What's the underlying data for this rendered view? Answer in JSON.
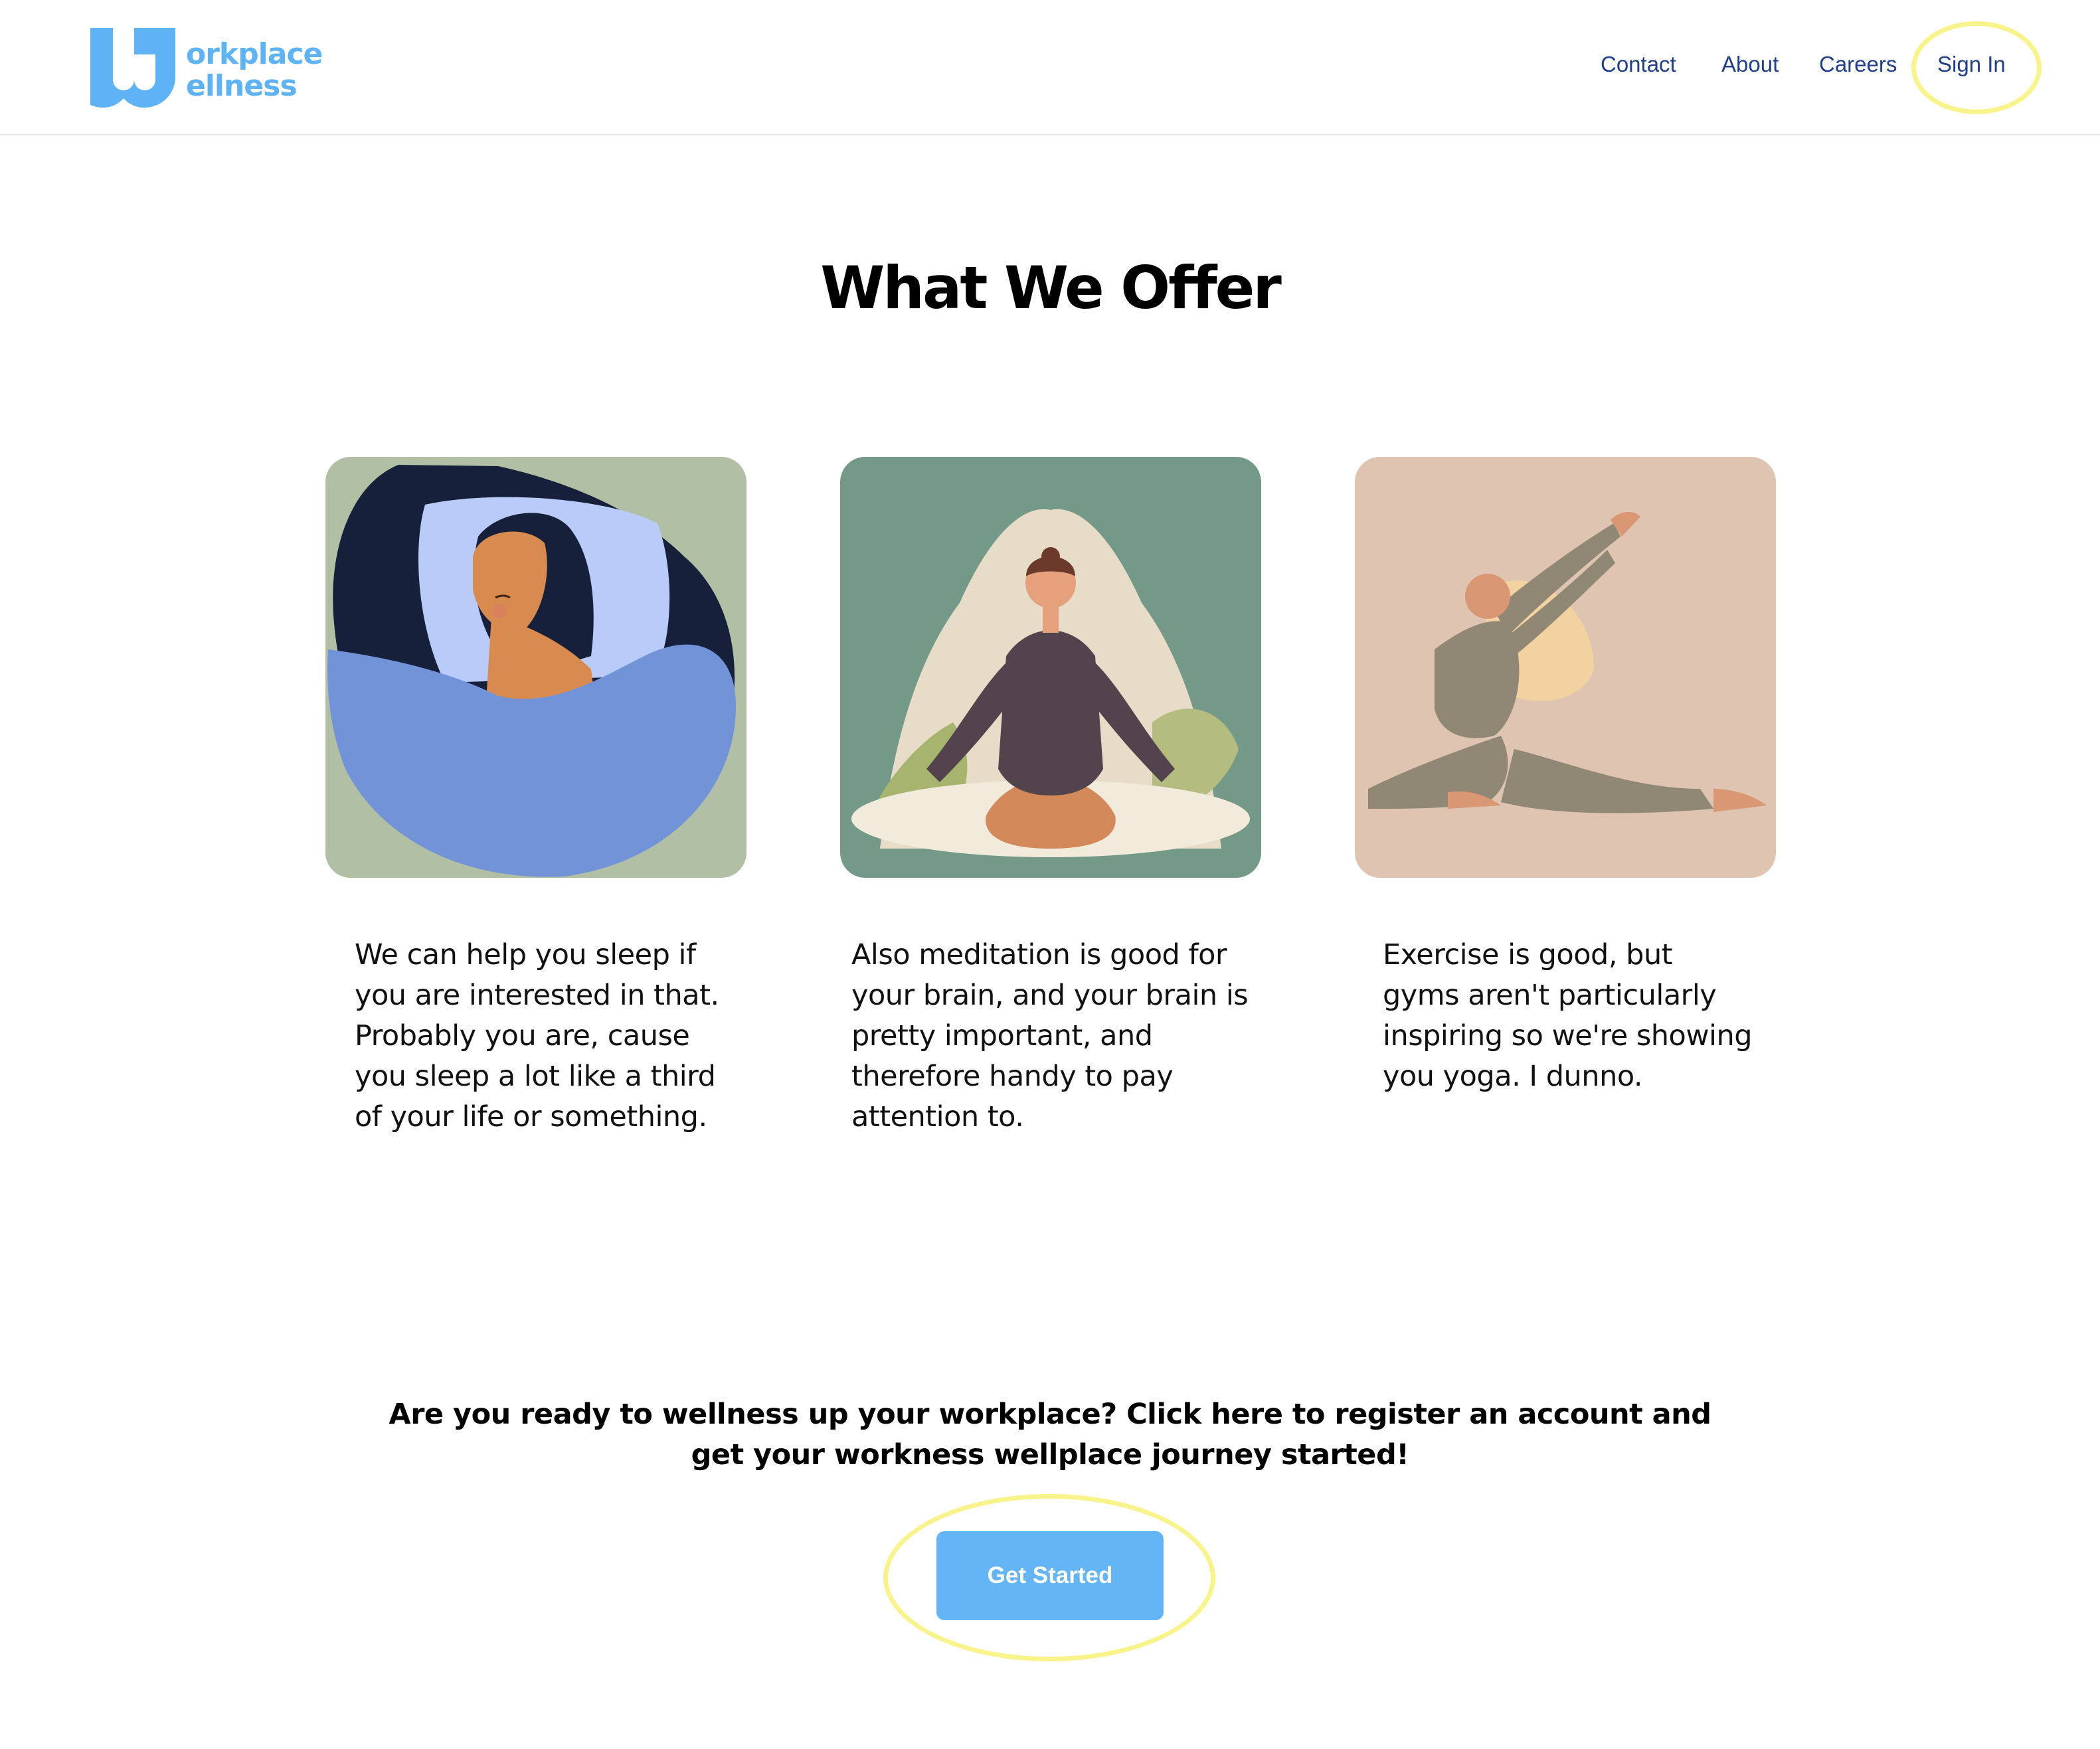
{
  "header": {
    "logo": {
      "line1": "orkplace",
      "line2": "ellness",
      "brand_color": "#5eb3f5"
    },
    "nav": [
      {
        "label": "Contact"
      },
      {
        "label": "About"
      },
      {
        "label": "Careers"
      },
      {
        "label": "Sign In",
        "highlighted": true
      }
    ],
    "nav_color": "#1f3e8c",
    "highlight_color": "#f8f38a"
  },
  "main": {
    "title": "What We Offer",
    "cards": [
      {
        "image": "sleeping-woman-illustration",
        "text": "We can help you sleep if you are interested in that. Probably you are, cause you sleep a lot like a third of your life or something."
      },
      {
        "image": "meditating-woman-illustration",
        "text": "Also meditation is good for your brain, and your brain is pretty important, and therefore handy to pay attention to."
      },
      {
        "image": "yoga-woman-illustration",
        "text": "Exercise is good, but gyms aren't particularly inspiring so we're showing you yoga. I dunno."
      }
    ],
    "cta": {
      "text": "Are you ready to wellness up your workplace? Click here to register an account and get your workness wellplace journey started!",
      "button_label": "Get Started",
      "button_color": "#64b5f6",
      "highlighted": true
    }
  }
}
